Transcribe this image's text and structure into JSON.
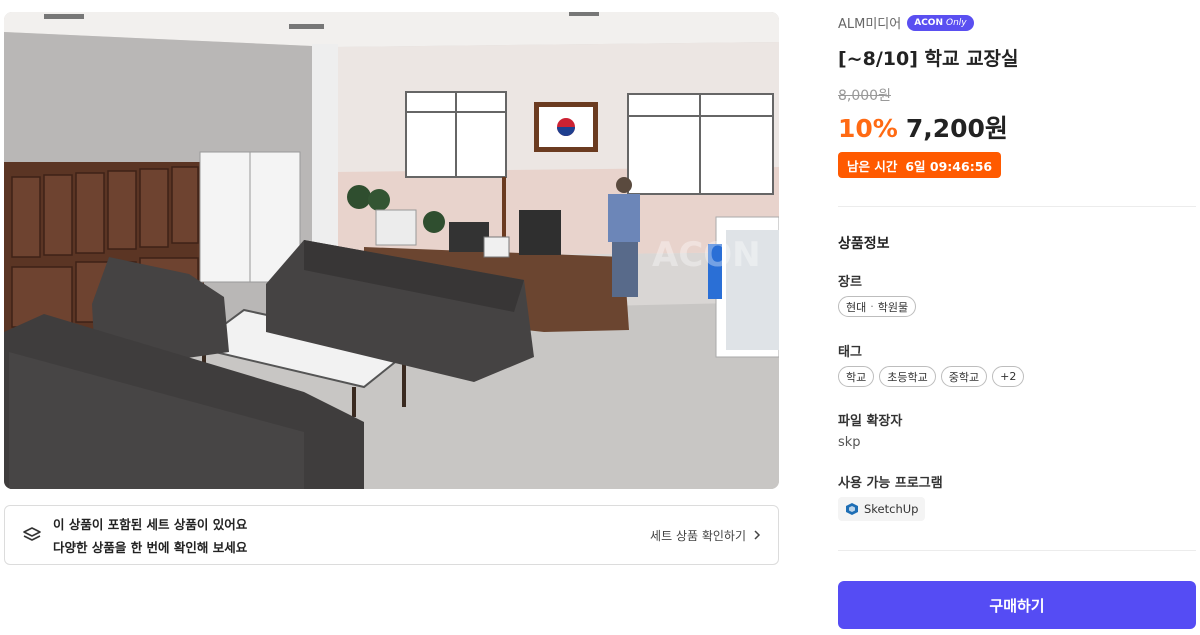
{
  "product": {
    "seller": "ALM미디어",
    "only_badge": {
      "brand": "ACON",
      "suffix": "Only"
    },
    "title": "[~8/10] 학교 교장실",
    "original_price": "8,000원",
    "discount": "10%",
    "price": "7,200원",
    "timer": {
      "label": "남은 시간",
      "value": "6일 09:46:56"
    }
  },
  "set_notice": {
    "line1": "이 상품이 포함된 세트 상품이 있어요",
    "line2": "다양한 상품을 한 번에 확인해 보세요",
    "link": "세트 상품 확인하기"
  },
  "info": {
    "section_title": "상품정보",
    "genre_label": "장르",
    "genre": {
      "a": "현대",
      "sep": "·",
      "b": "학원물"
    },
    "tag_label": "태그",
    "tags": [
      "학교",
      "초등학교",
      "중학교",
      "+2"
    ],
    "ext_label": "파일 확장자",
    "ext": "skp",
    "program_label": "사용 가능 프로그램",
    "program": "SketchUp"
  },
  "buy_button": "구매하기",
  "colors": {
    "accent": "#554cf4",
    "discount": "#ff6a13",
    "timer_bg": "#ff5a00"
  },
  "preview_image": {
    "watermark": "ACON"
  }
}
